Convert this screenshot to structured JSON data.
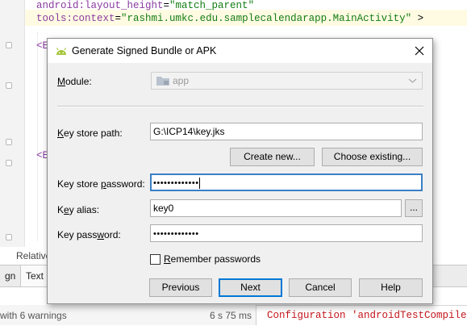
{
  "editor": {
    "code_lines": [
      {
        "attr": "android:layout_height",
        "eq": "=",
        "value": "\"match_parent\"",
        "tail": ""
      },
      {
        "attr": "tools:context",
        "eq": "=",
        "value": "\"rashmi.umkc.edu.samplecalendarapp.MainActivity\"",
        "tail": " >"
      }
    ],
    "tag_fragment_1": "<E",
    "tag_fragment_2": "<E",
    "relative_label": "Relative"
  },
  "bottom_tabs": {
    "design_label": "gn",
    "text_label": "Text"
  },
  "build": {
    "status": "with 6 warnings",
    "time": "6 s 75 ms",
    "console": "Configuration 'androidTestCompile' i"
  },
  "dialog": {
    "title": "Generate Signed Bundle or APK",
    "module": {
      "label": "Module:",
      "value": "app"
    },
    "key_store_path": {
      "label": "Key store path:",
      "value": "G:\\ICP14\\key.jks"
    },
    "create_new_label": "Create new...",
    "choose_existing_label": "Choose existing...",
    "key_store_password": {
      "label": "Key store password:",
      "masked": "•••••••••••••"
    },
    "key_alias": {
      "label": "Key alias:",
      "value": "key0",
      "browse_label": "..."
    },
    "key_password": {
      "label": "Key password:",
      "masked": "•••••••••••••"
    },
    "remember_passwords": {
      "label": "Remember passwords",
      "checked": false
    },
    "buttons": {
      "previous": "Previous",
      "next": "Next",
      "cancel": "Cancel",
      "help": "Help"
    }
  },
  "colors": {
    "android_green": "#a4c639",
    "focus_blue": "#3b7fc4",
    "default_button_border": "#0078d7"
  },
  "icons": {
    "title": "android-icon",
    "close": "close-icon",
    "module": "folder-icon",
    "dropdown": "chevron-down-icon"
  }
}
